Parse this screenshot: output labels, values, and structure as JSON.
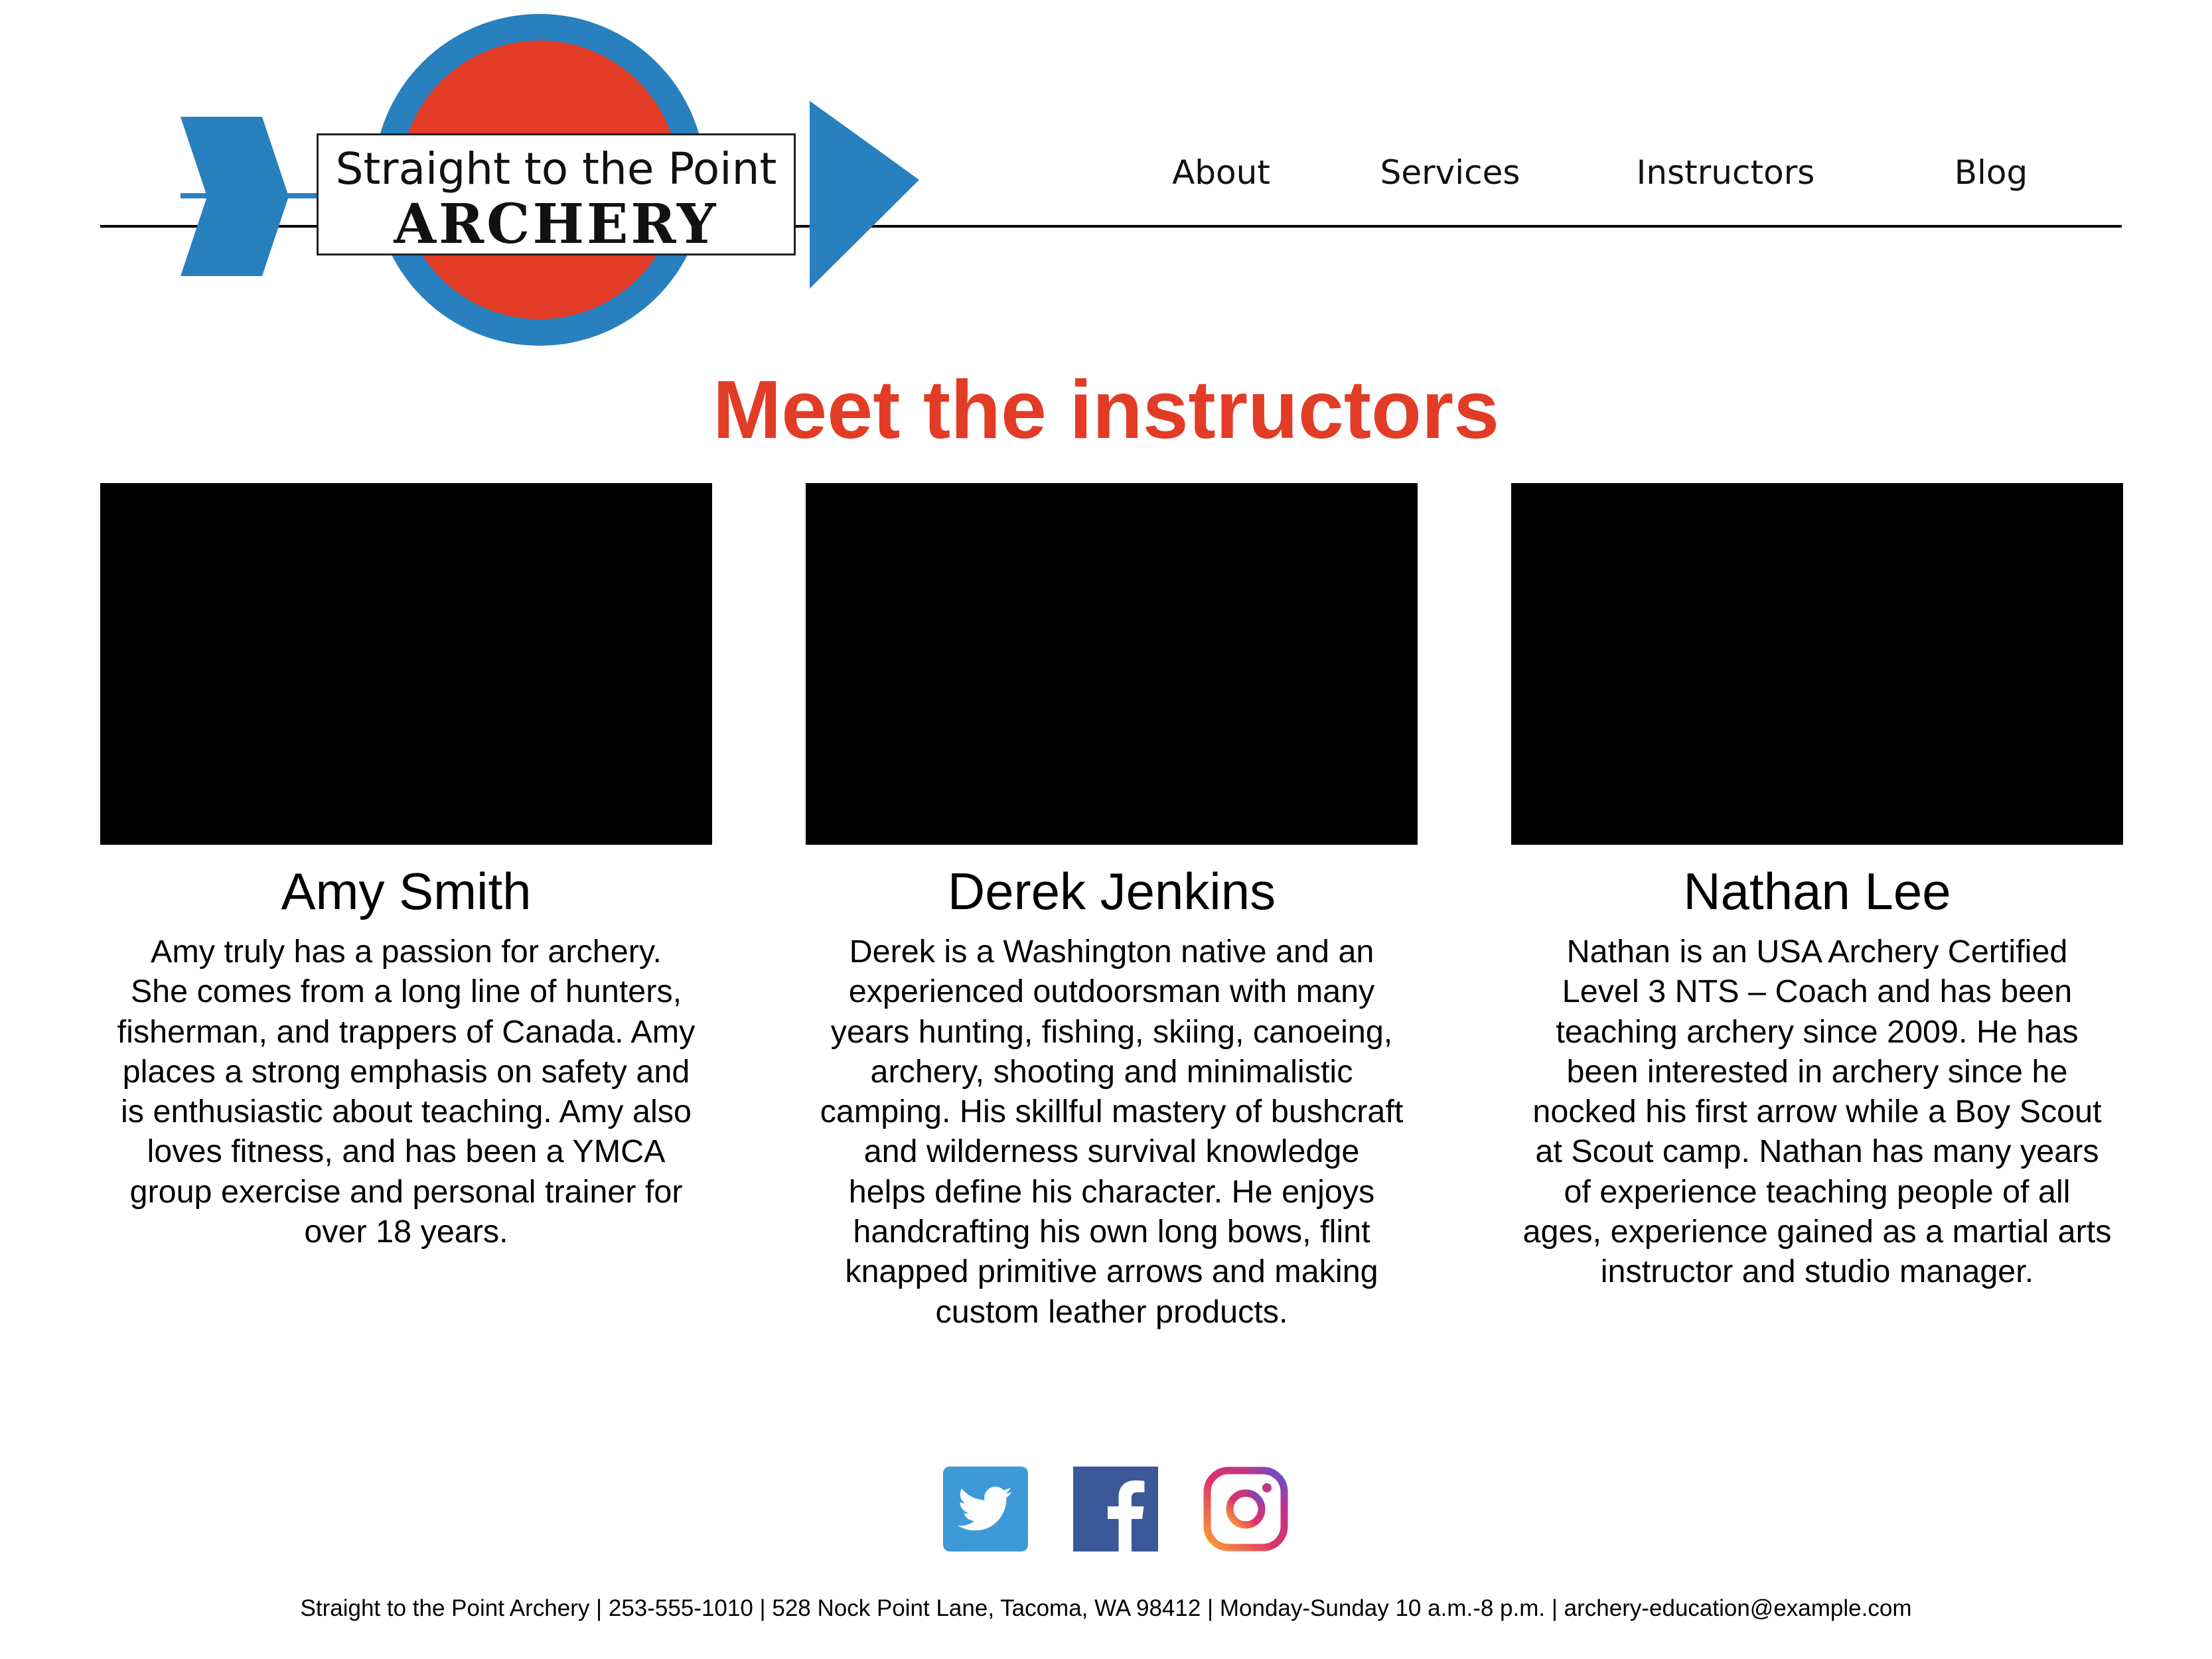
{
  "brand": {
    "line1": "Straight to the Point",
    "line2": "ARCHERY",
    "colors": {
      "blue": "#2980bf",
      "red": "#e23c26"
    }
  },
  "nav": {
    "items": [
      {
        "label": "About"
      },
      {
        "label": "Services"
      },
      {
        "label": "Instructors"
      },
      {
        "label": "Blog"
      }
    ]
  },
  "main": {
    "title": "Meet the instructors",
    "instructors": [
      {
        "name": "Amy Smith",
        "bio_lines": [
          "Amy truly has a passion for archery.",
          "She comes from a long line of hunters,",
          "fisherman, and trappers of Canada. Amy",
          "places a strong emphasis on safety and",
          "is enthusiastic about teaching. Amy also",
          "loves fitness, and  has been a YMCA",
          "group exercise and personal trainer for",
          "over 18 years."
        ]
      },
      {
        "name": "Derek Jenkins",
        "bio_lines": [
          "Derek is a Washington native and an",
          "experienced outdoorsman with many",
          "years hunting, fishing, skiing, canoeing,",
          "archery, shooting and minimalistic",
          "camping. His skillful mastery of bushcraft",
          "and wilderness survival knowledge",
          "helps define his character. He enjoys",
          "handcrafting his own long bows, flint",
          "knapped primitive arrows and making",
          "custom leather products."
        ]
      },
      {
        "name": "Nathan Lee",
        "bio_lines": [
          "Nathan is an USA Archery Certified",
          "Level 3 NTS – Coach and has been",
          "teaching archery since 2009. He has",
          "been interested in archery since he",
          "nocked his first arrow while a Boy Scout",
          "at Scout camp. Nathan has many years",
          "of experience teaching people of all",
          "ages, experience gained as a martial arts",
          "instructor and studio manager."
        ]
      }
    ]
  },
  "social": [
    {
      "icon": "twitter-icon",
      "color": "#3d9ad6"
    },
    {
      "icon": "facebook-icon",
      "color": "#3b5998"
    },
    {
      "icon": "instagram-icon",
      "color": "#c13584"
    }
  ],
  "footer": {
    "text": "Straight to the Point Archery | 253-555-1010 | 528 Nock Point Lane, Tacoma, WA 98412 |  Monday-Sunday 10 a.m.-8 p.m. | archery-education@example.com"
  }
}
